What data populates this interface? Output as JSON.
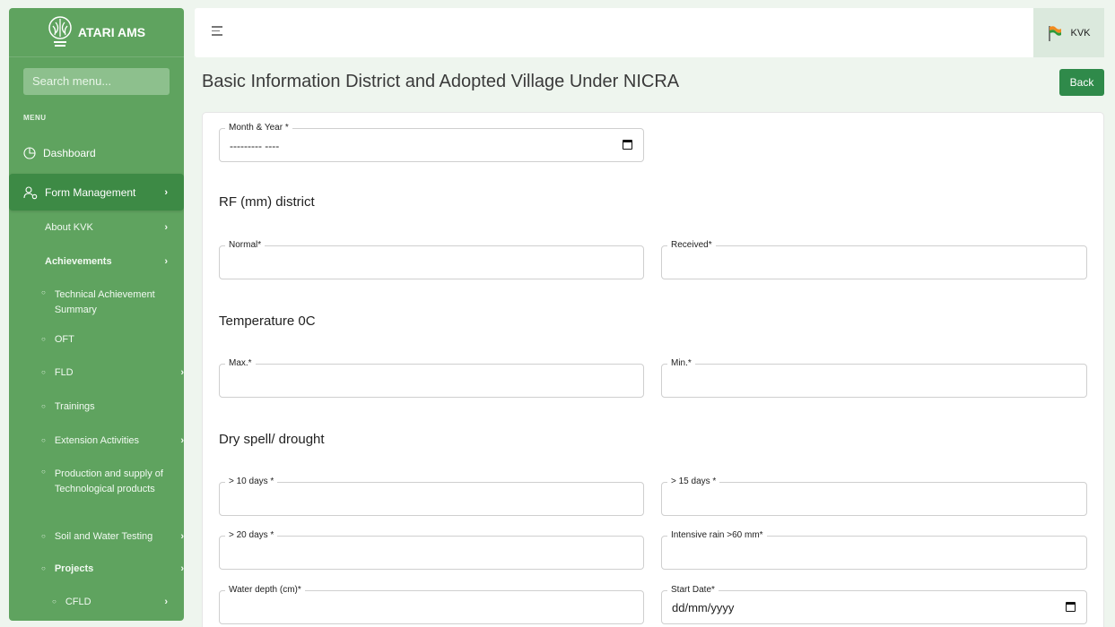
{
  "sidebar": {
    "brand": "ATARI AMS",
    "search_placeholder": "Search menu...",
    "menu_heading": "MENU",
    "dashboard": "Dashboard",
    "form_management": "Form Management",
    "about_kvk": "About KVK",
    "achievements": "Achievements",
    "items": {
      "technical_achievement_summary": "Technical Achievement Summary",
      "oft": "OFT",
      "fld": "FLD",
      "trainings": "Trainings",
      "extension_activities": "Extension Activities",
      "production_supply": "Production and supply of Technological products",
      "soil_water_testing": "Soil and Water Testing",
      "projects": "Projects",
      "cfld": "CFLD"
    }
  },
  "topbar": {
    "user_label": "KVK"
  },
  "page": {
    "title": "Basic Information District and Adopted Village Under NICRA",
    "back_label": "Back"
  },
  "form": {
    "month_year": {
      "label": "Month & Year *",
      "value": "--------- ----"
    },
    "rf_title": "RF (mm) district",
    "normal": {
      "label": "Normal*",
      "value": ""
    },
    "received": {
      "label": "Received*",
      "value": ""
    },
    "temp_title": "Temperature 0C",
    "max": {
      "label": "Max.*",
      "value": ""
    },
    "min": {
      "label": "Min.*",
      "value": ""
    },
    "dry_title": "Dry spell/ drought",
    "days10": {
      "label": "> 10 days *",
      "value": ""
    },
    "days15": {
      "label": "> 15 days *",
      "value": ""
    },
    "days20": {
      "label": "> 20 days *",
      "value": ""
    },
    "intensive_rain": {
      "label": "Intensive rain >60 mm*",
      "value": ""
    },
    "water_depth": {
      "label": "Water depth (cm)*",
      "value": ""
    },
    "start_date": {
      "label": "Start Date*",
      "value": "dd/mm/yyyy"
    }
  },
  "colors": {
    "sidebar_bg": "#5fa35f",
    "sidebar_active": "#3d8a45",
    "accent_button": "#2f8a4a",
    "page_bg": "#eef5ee"
  }
}
